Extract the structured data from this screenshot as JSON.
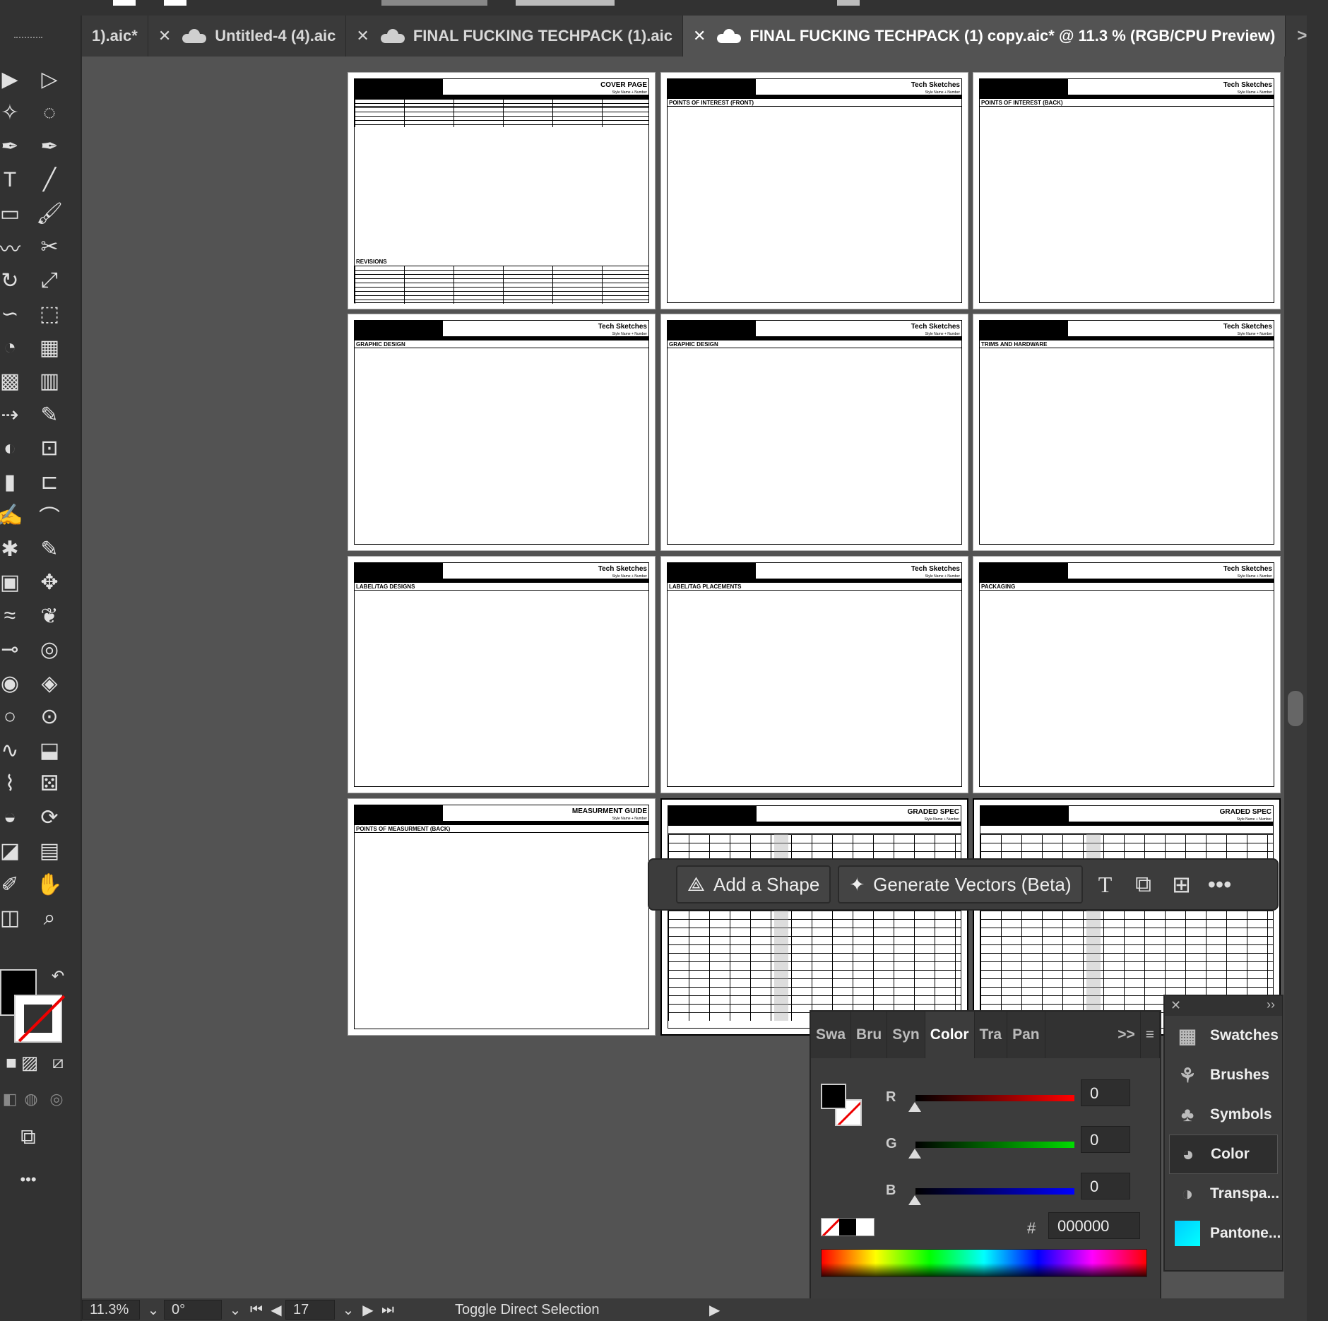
{
  "tabs": [
    {
      "label": "1).aic*",
      "cloud": false,
      "close": false
    },
    {
      "label": "Untitled-4 (4).aic",
      "cloud": true,
      "close": true
    },
    {
      "label": "FINAL FUCKING TECHPACK (1).aic",
      "cloud": true,
      "close": true
    },
    {
      "label": "FINAL FUCKING TECHPACK (1) copy.aic* @ 11.3 % (RGB/CPU Preview)",
      "cloud": true,
      "close": true,
      "active": true
    }
  ],
  "tab_more": ">>",
  "artboards": [
    {
      "header": "COVER PAGE",
      "sub": "Style Name + Number",
      "section": "REVISIONS",
      "kind": "cover"
    },
    {
      "header": "Tech Sketches",
      "sub": "Style Name + Number",
      "section": "POINTS OF INTEREST (FRONT)"
    },
    {
      "header": "Tech Sketches",
      "sub": "Style Name + Number",
      "section": "POINTS OF INTEREST (BACK)"
    },
    {
      "header": "Tech Sketches",
      "sub": "Style Name + Number",
      "section": "GRAPHIC DESIGN"
    },
    {
      "header": "Tech Sketches",
      "sub": "Style Name + Number",
      "section": "GRAPHIC DESIGN"
    },
    {
      "header": "Tech Sketches",
      "sub": "Style Name + Number",
      "section": "TRIMS AND HARDWARE"
    },
    {
      "header": "Tech Sketches",
      "sub": "Style Name + Number",
      "section": "LABEL/TAG DESIGNS"
    },
    {
      "header": "Tech Sketches",
      "sub": "Style Name + Number",
      "section": "LABEL/TAG PLACEMENTS"
    },
    {
      "header": "Tech Sketches",
      "sub": "Style Name + Number",
      "section": "PACKAGING"
    },
    {
      "header": "MEASURMENT GUIDE",
      "sub": "Style Name + Number",
      "section": "POINTS OF MEASURMENT (BACK)"
    },
    {
      "header": "GRADED SPEC",
      "sub": "Style Name + Number",
      "section": "",
      "kind": "spec"
    },
    {
      "header": "GRADED SPEC",
      "sub": "Style Name + Number",
      "section": "",
      "kind": "spec"
    }
  ],
  "context_bar": {
    "add_shape": "Add a Shape",
    "generate_vectors": "Generate Vectors (Beta)"
  },
  "color_panel": {
    "tabs": [
      "Swa",
      "Bru",
      "Syn",
      "Color",
      "Tra",
      "Pan"
    ],
    "active_tab": "Color",
    "more": ">>",
    "r_label": "R",
    "g_label": "G",
    "b_label": "B",
    "r": "0",
    "g": "0",
    "b": "0",
    "hash": "#",
    "hex": "000000"
  },
  "side_panel": {
    "items": [
      "Swatches",
      "Brushes",
      "Symbols",
      "Color",
      "Transpa...",
      "Pantone..."
    ],
    "active": "Color",
    "close": "✕",
    "collapse": "››"
  },
  "status": {
    "zoom": "11.3%",
    "rotation": "0°",
    "artboard_number": "17",
    "tool_hint": "Toggle Direct Selection"
  },
  "colors": {
    "fill": "#000000",
    "stroke": "none",
    "accent_red": "#ff0000"
  }
}
